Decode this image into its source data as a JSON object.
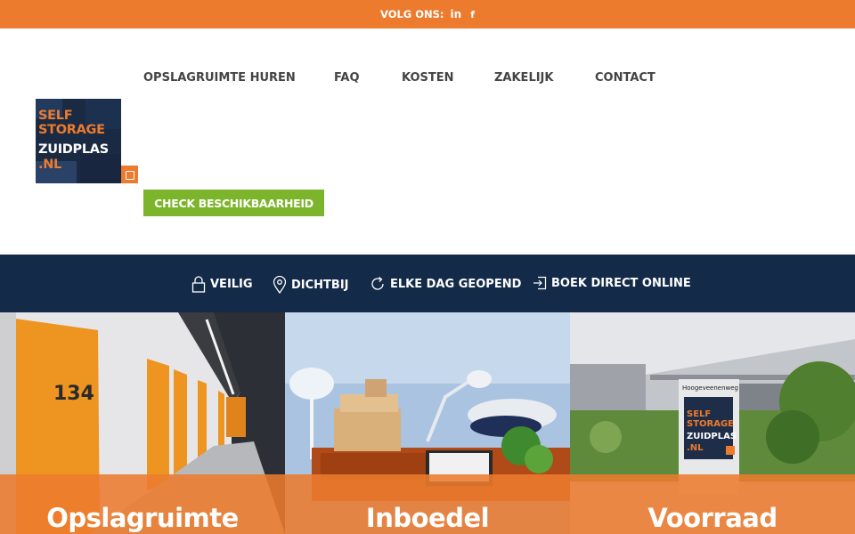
{
  "topbar": {
    "follow_label": "VOLG ONS:",
    "linkedin_icon": "in",
    "facebook_icon": "f"
  },
  "logo": {
    "line1": "SELF",
    "line2": "STORAGE",
    "line3": "ZUIDPLAS",
    "line4": ".NL"
  },
  "nav": {
    "items": [
      {
        "label": "OPSLAGRUIMTE HUREN"
      },
      {
        "label": "FAQ"
      },
      {
        "label": "KOSTEN"
      },
      {
        "label": "ZAKELIJK"
      },
      {
        "label": "CONTACT"
      }
    ]
  },
  "cta": {
    "label": "CHECK BESCHIKBAARHEID"
  },
  "usp": {
    "items": [
      {
        "label": "VEILIG",
        "icon": "lock-icon"
      },
      {
        "label": "DICHTBIJ",
        "icon": "map-pin-icon"
      },
      {
        "label": "ELKE DAG GEOPEND",
        "icon": "refresh-icon"
      },
      {
        "label": "BOEK DIRECT ONLINE",
        "icon": "login-icon"
      }
    ]
  },
  "tiles": [
    {
      "title": "Opslagruimte"
    },
    {
      "title": "Inboedel"
    },
    {
      "title": "Voorraad"
    }
  ],
  "sign": {
    "line1": "SELF",
    "line2": "STORAGE",
    "line3": "ZUIDPLAS",
    "line4": ".NL",
    "street": "Hoogeveenenweg"
  },
  "unit": {
    "number": "134"
  },
  "colors": {
    "orange": "#ec7b2d",
    "navy": "#132a48",
    "green": "#7cb52c",
    "text": "#444444"
  }
}
